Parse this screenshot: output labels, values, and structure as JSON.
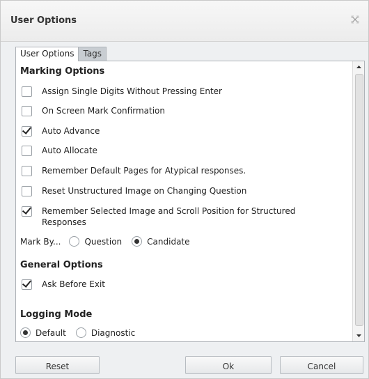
{
  "dialog": {
    "title": "User Options",
    "close_icon": "close-icon"
  },
  "tabs": [
    {
      "label": "User Options",
      "active": true
    },
    {
      "label": "Tags",
      "active": false
    }
  ],
  "marking_options": {
    "heading": "Marking Options",
    "items": [
      {
        "label": "Assign Single Digits Without Pressing Enter",
        "checked": false
      },
      {
        "label": "On Screen Mark Confirmation",
        "checked": false
      },
      {
        "label": "Auto Advance",
        "checked": true
      },
      {
        "label": "Auto Allocate",
        "checked": false
      },
      {
        "label": "Remember Default Pages for Atypical responses.",
        "checked": false
      },
      {
        "label": "Reset Unstructured Image on Changing Question",
        "checked": false
      },
      {
        "label_line1": "Remember Selected Image and Scroll Position for Structured",
        "label_line2": "Responses",
        "checked": true
      }
    ],
    "mark_by": {
      "label": "Mark By...",
      "options": [
        {
          "label": "Question",
          "selected": false
        },
        {
          "label": "Candidate",
          "selected": true
        }
      ]
    }
  },
  "general_options": {
    "heading": "General Options",
    "items": [
      {
        "label": "Ask Before Exit",
        "checked": true
      }
    ]
  },
  "logging_mode": {
    "heading": "Logging Mode",
    "options": [
      {
        "label": "Default",
        "selected": true
      },
      {
        "label": "Diagnostic",
        "selected": false
      }
    ]
  },
  "buttons": {
    "reset": "Reset",
    "ok": "Ok",
    "cancel": "Cancel"
  }
}
